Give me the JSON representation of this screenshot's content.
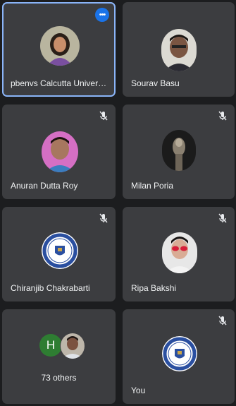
{
  "participants": [
    {
      "name": "pbenvs Calcutta Universi..."
    },
    {
      "name": "Sourav Basu"
    },
    {
      "name": "Anuran Dutta Roy"
    },
    {
      "name": "Milan Poria"
    },
    {
      "name": "Chiranjib Chakrabarti"
    },
    {
      "name": "Ripa Bakshi"
    }
  ],
  "others": {
    "avatar_letter": "H",
    "label": "73 others"
  },
  "self": {
    "name": "You"
  },
  "icons": {
    "mic_muted": "mic-off-icon",
    "more_options": "more-options-icon",
    "logo": "university-logo"
  },
  "colors": {
    "tile_bg": "#3c3d40",
    "page_bg": "#1c1d1f",
    "active_border": "#8ab4f8",
    "more_button": "#1a73e8",
    "letter_avatar": "#2e7d32"
  }
}
